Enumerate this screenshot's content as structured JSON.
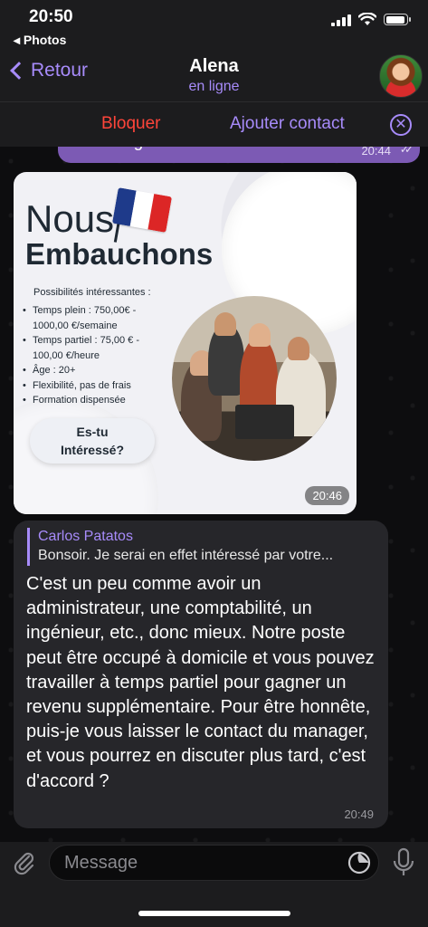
{
  "status_bar": {
    "time": "20:50",
    "back_label": "◂ Photos",
    "battery_level": 0.95
  },
  "header": {
    "back_label": "Retour",
    "contact_name": "Alena",
    "contact_status": "en ligne"
  },
  "action_bar": {
    "block_label": "Bloquer",
    "add_contact_label": "Ajouter contact",
    "close_icon": "⊗"
  },
  "messages": {
    "previous": {
      "text": "davantage merci.",
      "time": "20:44",
      "checks": "✓✓"
    },
    "image": {
      "title_line1": "Nous",
      "title_line2": "Embauchons",
      "possibilities_title": "Possibilités intéressantes :",
      "possibilities": [
        "Temps plein : 750,00€ - 1000,00 €/semaine",
        "Temps partiel : 75,00 € - 100,00 €/heure",
        "Âge : 20+",
        "Flexibilité, pas de frais",
        "Formation dispensée"
      ],
      "cta_line1": "Es-tu",
      "cta_line2": "Intéressé?",
      "time": "20:46"
    },
    "reply": {
      "quote_name": "Carlos Patatos",
      "quote_text": "Bonsoir. Je serai en effet intéressé par votre...",
      "text": "C'est un peu comme avoir un administrateur, une comptabilité, un ingénieur, etc., donc mieux. Notre poste peut être occupé à domicile et vous pouvez travailler à temps partiel pour gagner un revenu supplémentaire. Pour être honnête, puis-je vous laisser le contact du manager, et vous pourrez en discuter plus tard,  c'est d'accord ?",
      "time": "20:49"
    }
  },
  "input": {
    "placeholder": "Message"
  },
  "colors": {
    "accent": "#a78bfa",
    "danger": "#ff453a",
    "outgoing_bubble": "#7c5ab4",
    "incoming_bubble": "#26262a"
  }
}
